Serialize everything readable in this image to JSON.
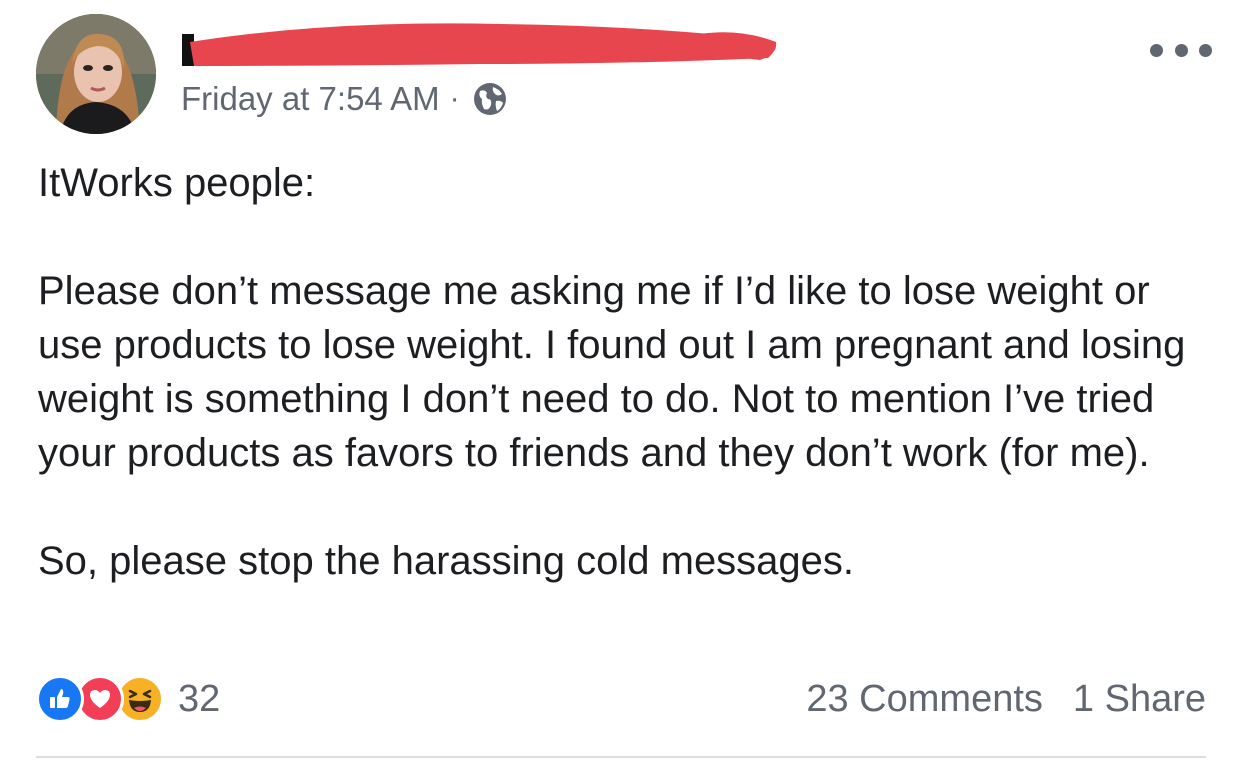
{
  "post": {
    "timestamp": "Friday at 7:54 AM",
    "separator": "·",
    "privacy_icon": "globe-icon",
    "menu_icon": "more-horizontal-icon",
    "paragraphs": [
      "ItWorks people:",
      "Please don’t message me asking me if I’d like to lose weight or use products to lose weight. I found out I am pregnant and losing weight is something I don’t need to do. Not to mention I’ve tried your products as favors to friends and they don’t work (for me).",
      "So, please stop the harassing cold messages."
    ],
    "redaction_color": "#e8464f"
  },
  "footer": {
    "reaction_icons": [
      "like-icon",
      "love-icon",
      "haha-icon"
    ],
    "reaction_count": "32",
    "comments": "23 Comments",
    "shares": "1 Share"
  },
  "colors": {
    "text": "#1c1e21",
    "meta": "#616770",
    "like": "#1877f2",
    "love": "#f33e58",
    "haha": "#f7b125"
  }
}
